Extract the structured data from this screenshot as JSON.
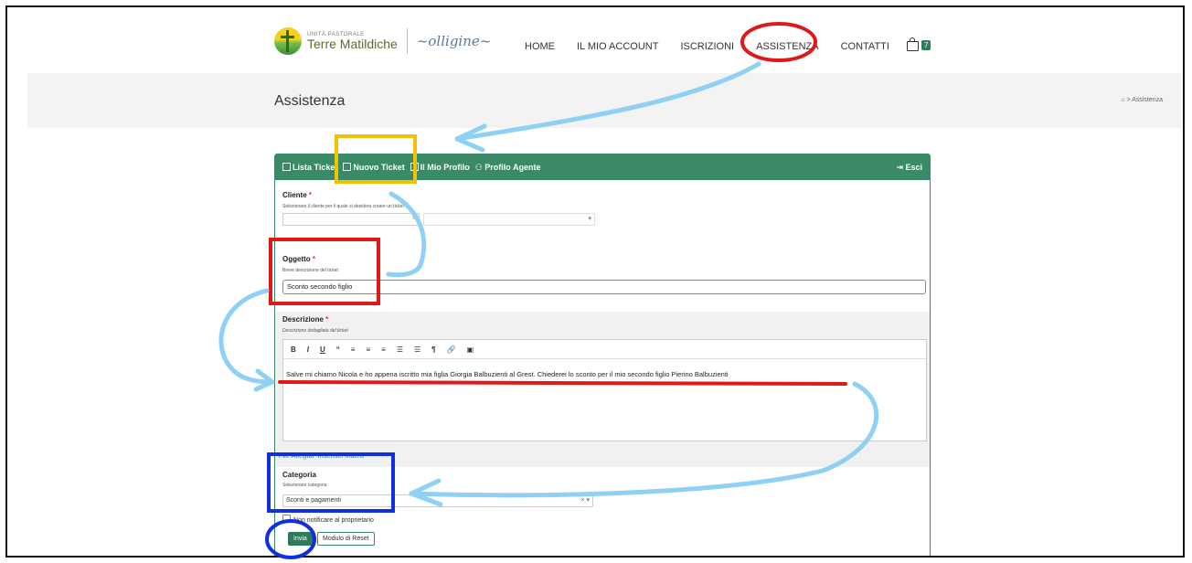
{
  "header": {
    "logo_small": "UNITÀ PASTORALE",
    "logo_big": "Terre Matildiche",
    "nav": [
      "HOME",
      "IL MIO ACCOUNT",
      "ISCRIZIONI",
      "ASSISTENZA",
      "CONTATTI"
    ],
    "cart_count": "7"
  },
  "titlebar": {
    "title": "Assistenza",
    "breadcrumb": "Assistenza"
  },
  "panel": {
    "tabs": [
      "Lista Ticket",
      "Nuovo Ticket",
      "Il Mio Profilo",
      "Profilo Agente"
    ],
    "exit_label": "Esci",
    "cliente": {
      "label": "Cliente",
      "hint": "Selezionare il cliente per il quale si desidera creare un ticket",
      "value": ""
    },
    "oggetto": {
      "label": "Oggetto",
      "hint": "Breve descrizione del ticket",
      "value": "Sconto secondo figlio"
    },
    "descrizione": {
      "label": "Descrizione",
      "hint": "Descrizione dettagliata del ticket",
      "toolbar": [
        "B",
        "I",
        "U",
        "“",
        "≡",
        "≡",
        "≡",
        "☰",
        "☰",
        "¶",
        "🔗",
        "▣"
      ],
      "text": "Salve mi chiamo Nicola e ho appena iscritto mia figlia Giorgia Balbuzienti al Grest. Chiederei lo sconto per il mio secondo figlio Pierino Balbuzienti"
    },
    "links": [
      "File Allegati",
      "Inserisci Macro"
    ],
    "categoria": {
      "label": "Categoria",
      "hint": "Selezionare categoria",
      "value": "Sconti e pagamenti"
    },
    "checkbox_label": "Non notificare al proprietario",
    "submit_label": "Invia",
    "reset_label": "Modulo di Reset"
  },
  "colors": {
    "accent": "#3b8a67",
    "annotation_red": "#e01818",
    "annotation_blue": "#1030e0",
    "annotation_yellow": "#f5c000",
    "arrow_lightblue": "#8fd0f5"
  }
}
